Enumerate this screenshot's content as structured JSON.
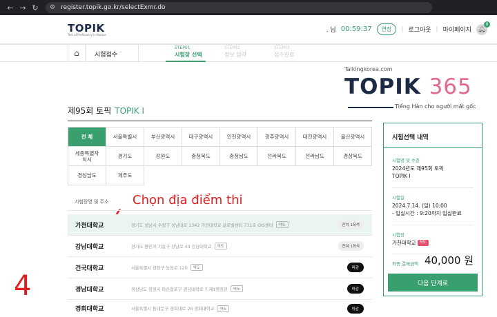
{
  "browser": {
    "url": "register.topik.go.kr/selectExmr.do",
    "nav_icons": [
      "back-icon",
      "forward-icon",
      "reload-icon",
      "tune-icon"
    ]
  },
  "header": {
    "logo_text": "TOPIK",
    "logo_tagline": "Test of Proficiency in Korean",
    "user_suffix": ". 님",
    "timer": "00:59:37",
    "extend_label": "연장",
    "logout_label": "로그아웃",
    "mypage_label": "마이페이지",
    "notification_count": "0"
  },
  "steps": {
    "home_icon": "home-icon",
    "breadcrumb": "시험접수",
    "items": [
      {
        "num": "STEP01",
        "label": "시험장 선택",
        "active": true
      },
      {
        "num": "STEP02",
        "label": "정보 입력",
        "active": false
      },
      {
        "num": "STEP03",
        "label": "접수완료",
        "active": false
      }
    ]
  },
  "watermark": {
    "url": "Talkingkorea.com",
    "word": "TOPIK",
    "number": "365",
    "subtitle": "Tiếng Hàn cho người mất gốc"
  },
  "page": {
    "title": "제95회 토픽",
    "exam_name": "TOPIK Ⅰ"
  },
  "regions": [
    {
      "label": "전 체",
      "active": true
    },
    {
      "label": "서울특별시"
    },
    {
      "label": "부산광역시"
    },
    {
      "label": "대구광역시"
    },
    {
      "label": "인천광역시"
    },
    {
      "label": "광주광역시"
    },
    {
      "label": "대전광역시"
    },
    {
      "label": "울산광역시"
    },
    {
      "label": "세종특별자\n치시"
    },
    {
      "label": "경기도"
    },
    {
      "label": "강원도"
    },
    {
      "label": "충청북도"
    },
    {
      "label": "충청남도"
    },
    {
      "label": "전라북도"
    },
    {
      "label": "전라남도"
    },
    {
      "label": "경상북도"
    },
    {
      "label": "경상남도"
    },
    {
      "label": "제주도"
    }
  ],
  "list": {
    "header": "시험장명 및 주소",
    "map_label": "약도",
    "rows": [
      {
        "name": "가천대학교",
        "address": "경기도 성남시 수정구 성남대로 1342 가천대학교 글로벌센터 731호 OIS센터",
        "status": "잔여 1좌석",
        "status_type": "avail",
        "selected": true
      },
      {
        "name": "강남대학교",
        "address": "경기도 용인시 기흥구 강남로 40 강남대학교",
        "status": "잔여 1좌석",
        "status_type": "avail",
        "selected": false
      },
      {
        "name": "건국대학교",
        "address": "서울특별시 광진구 능동로 120",
        "status": "마감",
        "status_type": "closed",
        "selected": false
      },
      {
        "name": "경남대학교",
        "address": "경상남도 창원시 마산합포구 경남대학로 7 제1행정관",
        "status": "마감",
        "status_type": "closed",
        "selected": false
      },
      {
        "name": "경희대학교",
        "address": "서울특별시 동대문구 경희대로 26 경희대학교",
        "status": "마감",
        "status_type": "closed",
        "selected": false
      }
    ]
  },
  "annotations": {
    "instruction": "Chọn địa điểm thi",
    "check": "✓",
    "step_number": "4"
  },
  "panel": {
    "title": "시험선택 내역",
    "exam_label": "시험명 및 수준",
    "exam_value_line1": "2024년도 제95회 토픽",
    "exam_value_line2": "TOPIK Ⅰ",
    "date_label": "시험일",
    "date_line1": "2024.7.14. (일) 10:00",
    "date_line2": "- 입실시간 : 9:20까지 입실완료",
    "site_label": "시험장",
    "site_value": "가천대학교",
    "site_tag": "약도",
    "fee_label": "최종 결제금액",
    "fee_value": "40,000 원",
    "next_label": "다음 단계로"
  },
  "colors": {
    "accent": "#3a9f6f",
    "annotation": "#e02020",
    "closed_pill": "#111111"
  }
}
